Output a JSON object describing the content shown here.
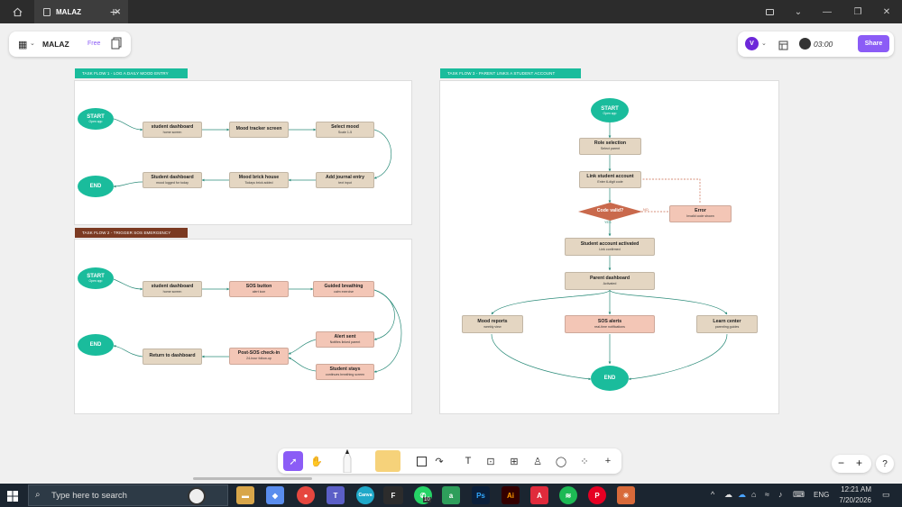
{
  "tabbar": {
    "home_icon": "home-icon",
    "tab_title": "MALAZ",
    "new_tab_label": "+"
  },
  "toolbar": {
    "file_name": "MALAZ",
    "plan_badge": "Free",
    "avatar_initial": "V",
    "timer": "03:00",
    "share_label": "Share"
  },
  "flow1": {
    "label": "TASK FLOW 1 - LOG A DAILY MOOD ENTRY",
    "start": {
      "title": "START",
      "sub": "Open app"
    },
    "end": {
      "title": "END"
    },
    "nodes": [
      {
        "title": "student dashboard",
        "sub": "home screen"
      },
      {
        "title": "Mood tracker screen",
        "sub": ""
      },
      {
        "title": "Select mood",
        "sub": "Scale 1-5"
      },
      {
        "title": "Add journal entry",
        "sub": "text input"
      },
      {
        "title": "Mood brick house",
        "sub": "Todays brick added"
      },
      {
        "title": "Student dashboard",
        "sub": "mood logged for today"
      }
    ]
  },
  "flow2": {
    "label": "TASK FLOW 2 - TRIGGER SOS EMERGENCY",
    "start": {
      "title": "START",
      "sub": "Open app"
    },
    "end": {
      "title": "END"
    },
    "nodes": [
      {
        "title": "student dashboard",
        "sub": "home screen"
      },
      {
        "title": "SOS button",
        "sub": "alert icon"
      },
      {
        "title": "Guided breathing",
        "sub": "calm exercise"
      },
      {
        "title": "Alert sent",
        "sub": "Notifies linked parent"
      },
      {
        "title": "Student stays",
        "sub": "continues breathing screen"
      },
      {
        "title": "Post-SOS check-in",
        "sub": "24-hour follow-up"
      },
      {
        "title": "Return to dashboard",
        "sub": ""
      }
    ]
  },
  "flow3": {
    "label": "TASK FLOW 3 - PARENT LINKS A STUDENT ACCOUNT",
    "start": {
      "title": "START",
      "sub": "Open app"
    },
    "end": {
      "title": "END"
    },
    "nodes": [
      {
        "title": "Role selection",
        "sub": "Select parent"
      },
      {
        "title": "Link student account",
        "sub": "Enter 6-digit code"
      },
      {
        "title": "Code valid?",
        "sub": ""
      },
      {
        "title": "Error",
        "sub": "Invalid code shown"
      },
      {
        "title": "Student account activated",
        "sub": "Link confirmed"
      },
      {
        "title": "Parent dashboard",
        "sub": "Activated"
      },
      {
        "title": "Mood reports",
        "sub": "weekly view"
      },
      {
        "title": "SOS alerts",
        "sub": "real-time notifications"
      },
      {
        "title": "Learn center",
        "sub": "parenting guides"
      }
    ],
    "yes_label": "YES",
    "no_label": "NO"
  },
  "zoom": {
    "minus": "−",
    "plus": "+",
    "help": "?"
  },
  "taskbar": {
    "search_placeholder": "Type here to search",
    "whatsapp_badge": "10",
    "lang": "ENG",
    "time": "12:21 AM",
    "date": "7/20/2026"
  },
  "colors": {
    "teal": "#1abc9c",
    "flow2_label": "#7b3a22",
    "beige": "#e4d6c2",
    "pink": "#f3c6b6",
    "diamond": "#c9694c",
    "share": "#8b5cf6"
  }
}
